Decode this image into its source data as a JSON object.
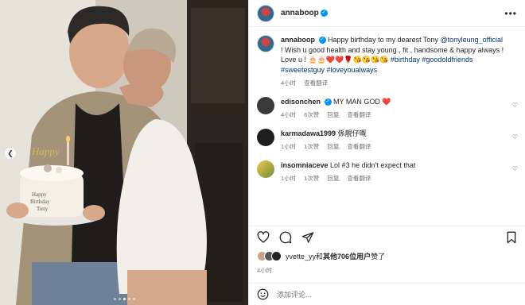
{
  "post": {
    "username": "annaboop",
    "more_label": "•••"
  },
  "caption": {
    "username": "annaboop",
    "text_1": "Happy birthday to my dearest Tony ",
    "mention": "@tonyleung_official",
    "text_2": " ! Wish u good health and stay young , fit , handsome & happy always ! Love u ! 🎂🎂❤️❤️🌹😘😘😘😘 ",
    "hashtags": "#birthday #goodoldfriends #sweetestguy #loveyoualways",
    "time": "4小时",
    "translate": "查看翻译"
  },
  "comments": [
    {
      "username": "edisonchen",
      "text": "MY MAN GOD ❤️",
      "time": "4小时",
      "likes": "6次赞",
      "reply": "回复",
      "translate": "查看翻译"
    },
    {
      "username": "karmadawa1999",
      "text": "係靚仔嘅",
      "time": "1小时",
      "likes": "1次赞",
      "reply": "回复",
      "translate": "查看翻译"
    },
    {
      "username": "insomniaceve",
      "text": "Lol #3 he didn't expect that",
      "time": "1小时",
      "likes": "1次赞",
      "reply": "回复",
      "translate": "查看翻译"
    }
  ],
  "likes_line": {
    "user": "yvette_yy",
    "mid": "和",
    "others": "其他706位用户",
    "end": "赞了"
  },
  "posted_time": "4小时",
  "add_comment": {
    "placeholder": "添加评论..."
  },
  "colors": {
    "link": "#00376b",
    "verified": "#0095f6",
    "heart": "#ed4956"
  },
  "icons": [
    "more-icon",
    "heart-icon",
    "comment-icon",
    "share-icon",
    "bookmark-icon",
    "emoji-icon",
    "prev-arrow-icon"
  ],
  "carousel": {
    "slide_count": 5,
    "active_slide": 1
  }
}
